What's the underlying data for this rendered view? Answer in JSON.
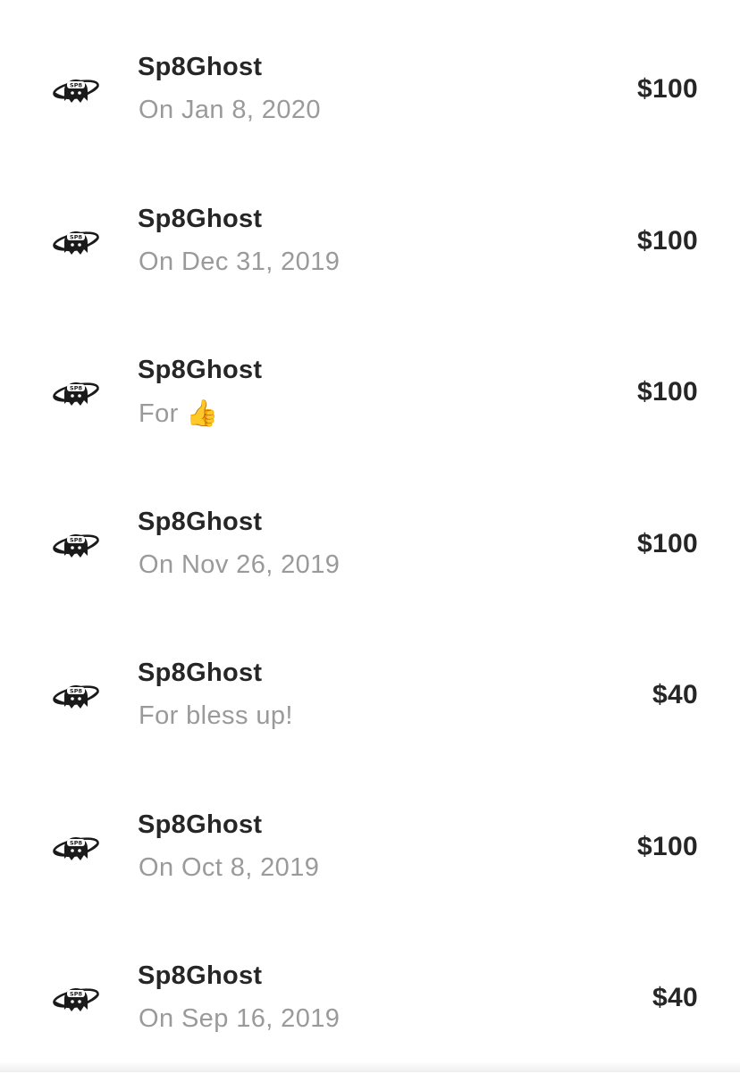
{
  "payments": [
    {
      "name": "Sp8Ghost",
      "subtitle": "On Jan 8, 2020",
      "amount": "$100"
    },
    {
      "name": "Sp8Ghost",
      "subtitle": "On Dec 31, 2019",
      "amount": "$100"
    },
    {
      "name": "Sp8Ghost",
      "subtitle": "For 👍",
      "amount": "$100"
    },
    {
      "name": "Sp8Ghost",
      "subtitle": "On Nov 26, 2019",
      "amount": "$100"
    },
    {
      "name": "Sp8Ghost",
      "subtitle": "For bless up!",
      "amount": "$40"
    },
    {
      "name": "Sp8Ghost",
      "subtitle": "On Oct 8, 2019",
      "amount": "$100"
    },
    {
      "name": "Sp8Ghost",
      "subtitle": "On Sep 16, 2019",
      "amount": "$40"
    }
  ],
  "avatar": {
    "icon": "sp8ghost-logo-icon",
    "logo_text": "SP8",
    "color": "#1a1a1a"
  },
  "colors": {
    "name_text": "#262626",
    "subtitle_text": "#9a9a9a",
    "amount_text": "#262626",
    "background": "#ffffff"
  }
}
